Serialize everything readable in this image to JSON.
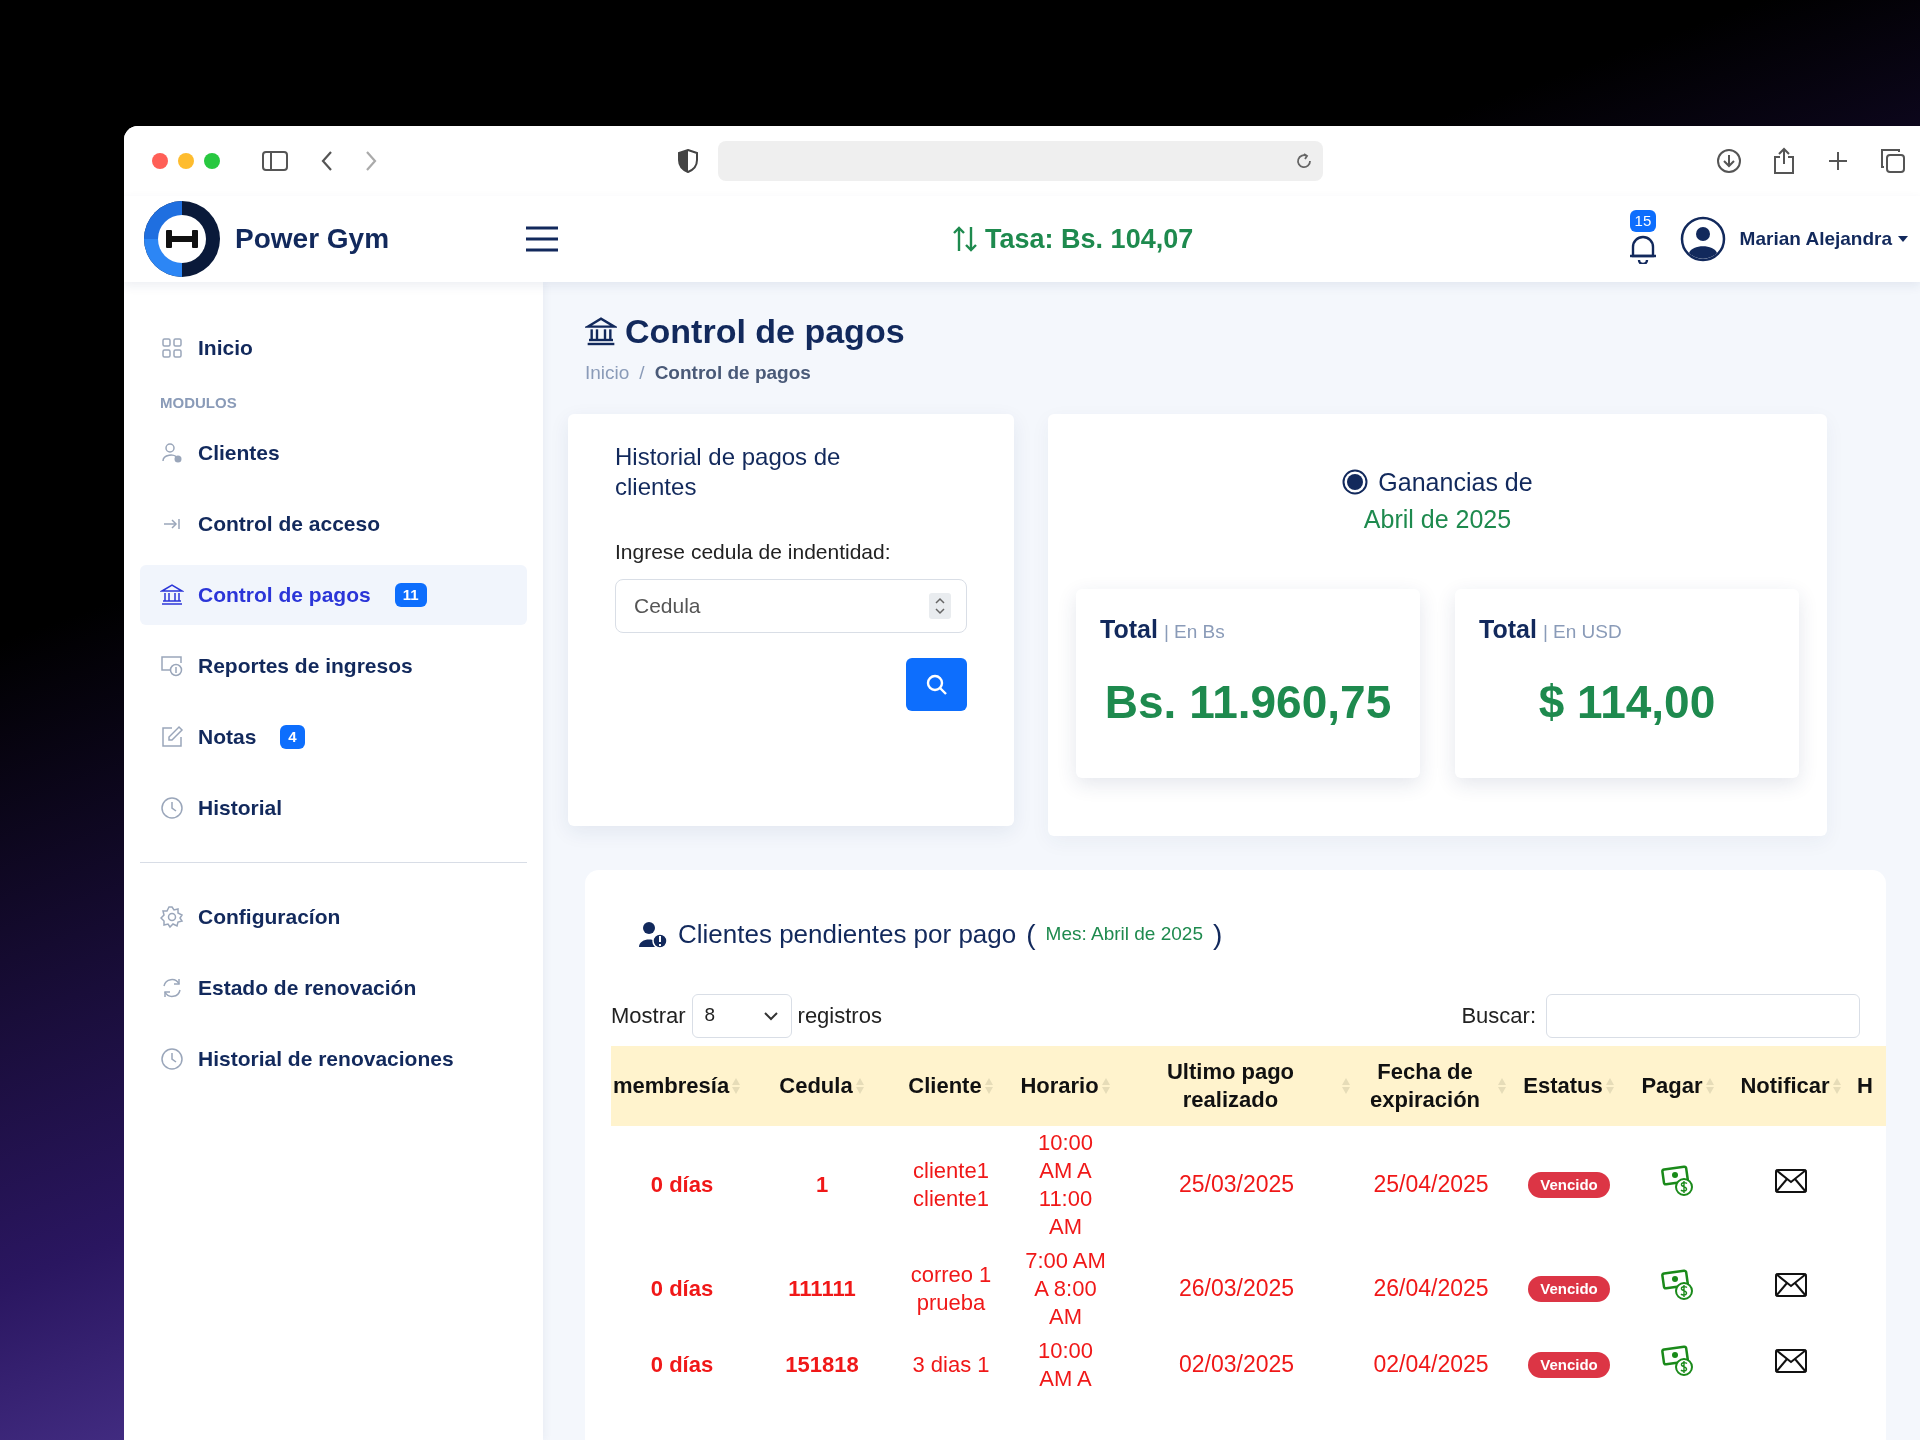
{
  "header": {
    "brand": "Power Gym",
    "rate": "Tasa: Bs. 104,07",
    "notifications": "15",
    "user": "Marian Alejandra"
  },
  "sidebar": {
    "top": [
      {
        "label": "Inicio",
        "selected": false
      }
    ],
    "section_label": "MODULOS",
    "modules": [
      {
        "label": "Clientes",
        "selected": false
      },
      {
        "label": "Control de acceso",
        "selected": false
      },
      {
        "label": "Control de pagos",
        "selected": true,
        "badge": "11"
      },
      {
        "label": "Reportes de ingresos",
        "selected": false
      },
      {
        "label": "Notas",
        "selected": false,
        "badge": "4"
      },
      {
        "label": "Historial",
        "selected": false
      }
    ],
    "bottom": [
      {
        "label": "Configuracíon",
        "selected": false
      },
      {
        "label": "Estado de renovación",
        "selected": false
      },
      {
        "label": "Historial de renovaciones",
        "selected": false
      }
    ]
  },
  "page": {
    "title": "Control de pagos",
    "breadcrumb": [
      "Inicio",
      "Control de pagos"
    ],
    "breadcrumb_separator": "/"
  },
  "search_card": {
    "title": "Historial de pagos de clientes",
    "label": "Ingrese cedula de indentidad:",
    "placeholder": "Cedula"
  },
  "earnings": {
    "title": "Ganancias de",
    "period": "Abril de 2025",
    "totals": [
      {
        "label": "Total",
        "unit": "| En Bs",
        "value": "Bs. 11.960,75"
      },
      {
        "label": "Total",
        "unit": "| En USD",
        "value": "$ 114,00"
      }
    ]
  },
  "pending": {
    "title": "Clientes pendientes por pago",
    "open_paren": "(",
    "month": "Mes: Abril de 2025",
    "close_paren": ")",
    "show_label": "Mostrar",
    "page_size": "8",
    "records_label": "registros",
    "search_label": "Buscar:",
    "columns": [
      {
        "label": "membresía",
        "sortable": true
      },
      {
        "label": "Cedula",
        "sortable": true
      },
      {
        "label": "Cliente",
        "sortable": true
      },
      {
        "label": "Horario",
        "sortable": true
      },
      {
        "label": "Ultimo pago realizado",
        "sortable": true
      },
      {
        "label": "Fecha de expiración",
        "sortable": true
      },
      {
        "label": "Estatus",
        "sortable": true
      },
      {
        "label": "Pagar",
        "sortable": true
      },
      {
        "label": "Notificar",
        "sortable": true
      },
      {
        "label": "H",
        "sortable": false
      }
    ],
    "rows": [
      {
        "days": "0 días",
        "cedula": "1",
        "client": "cliente1 cliente1",
        "schedule": "10:00 AM A 11:00 AM",
        "last_payment": "25/03/2025",
        "expiration": "25/04/2025",
        "status": "Vencido",
        "overdue": true
      },
      {
        "days": "0 días",
        "cedula": "111111",
        "client": "correo 1 prueba",
        "schedule": "7:00 AM A 8:00 AM",
        "last_payment": "26/03/2025",
        "expiration": "26/04/2025",
        "status": "Vencido",
        "overdue": true
      },
      {
        "days": "0 días",
        "cedula": "151818",
        "client": "3 dias 1",
        "schedule": "10:00 AM A",
        "last_payment": "02/03/2025",
        "expiration": "02/04/2025",
        "status": "Vencido",
        "overdue": true
      }
    ]
  }
}
